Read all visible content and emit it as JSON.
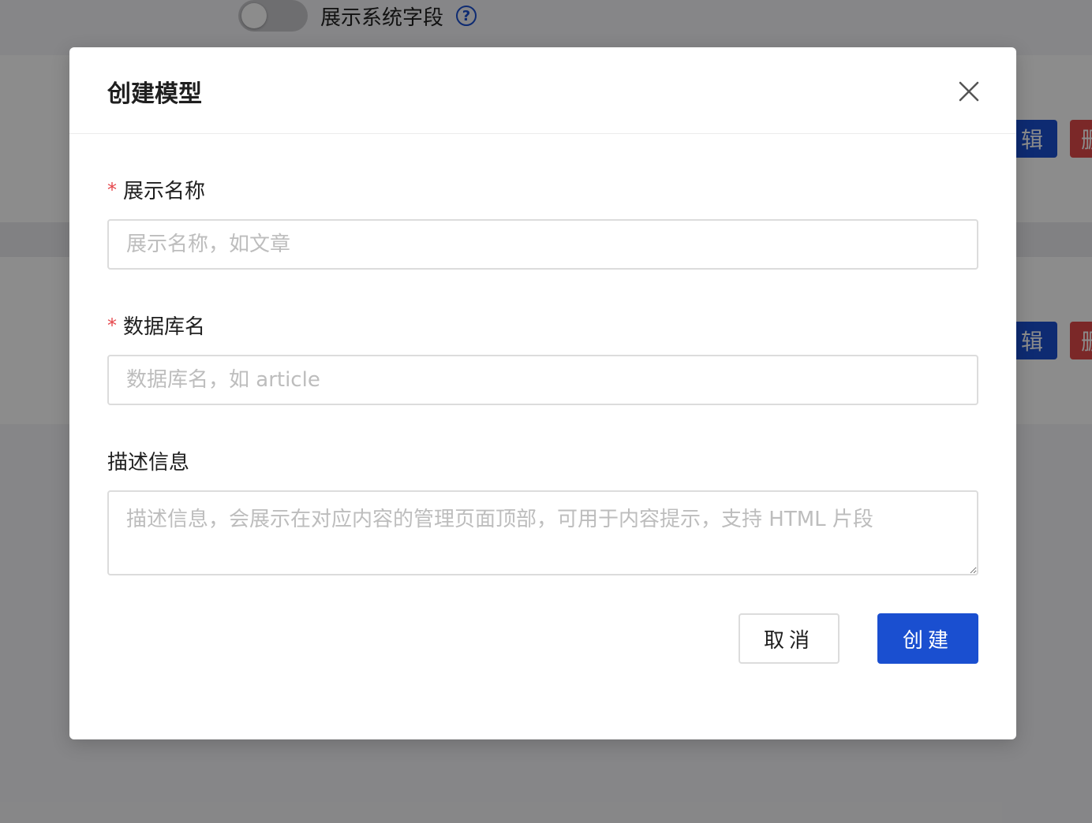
{
  "background": {
    "toggle_label": "展示系统字段",
    "help_icon": "question-circle-icon",
    "row_buttons": [
      {
        "edit_label": "辑",
        "delete_label": "删"
      },
      {
        "edit_label": "辑",
        "delete_label": "删"
      }
    ]
  },
  "modal": {
    "title": "创建模型",
    "close_icon": "close-icon",
    "fields": {
      "display_name": {
        "required_mark": "*",
        "label": "展示名称",
        "placeholder": "展示名称，如文章",
        "value": ""
      },
      "db_name": {
        "required_mark": "*",
        "label": "数据库名",
        "placeholder": "数据库名，如 article",
        "value": ""
      },
      "description": {
        "label": "描述信息",
        "placeholder": "描述信息，会展示在对应内容的管理页面顶部，可用于内容提示，支持 HTML 片段",
        "value": ""
      }
    },
    "buttons": {
      "cancel": "取消",
      "create": "创建"
    }
  },
  "colors": {
    "primary": "#1a4fd0",
    "danger": "#e04a4a",
    "required": "#e5484d"
  }
}
